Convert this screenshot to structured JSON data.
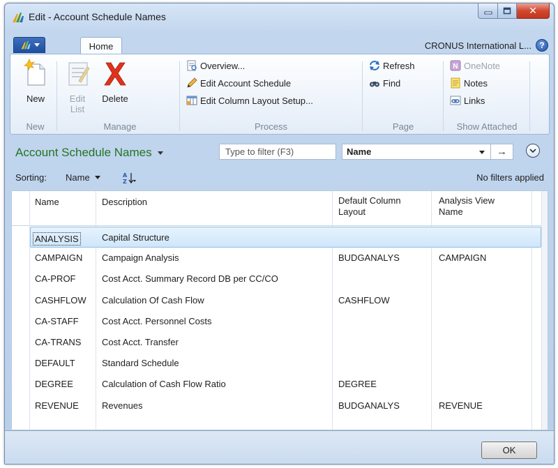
{
  "window": {
    "title": "Edit - Account Schedule Names",
    "company": "CRONUS International L...",
    "tab_home": "Home"
  },
  "ribbon": {
    "groups": {
      "new": "New",
      "manage": "Manage",
      "process": "Process",
      "page": "Page",
      "show_attached": "Show Attached"
    },
    "buttons": {
      "new": "New",
      "edit_list_1": "Edit",
      "edit_list_2": "List",
      "delete": "Delete",
      "overview": "Overview...",
      "edit_account_schedule": "Edit Account Schedule",
      "edit_column_layout": "Edit Column Layout Setup...",
      "refresh": "Refresh",
      "find": "Find",
      "onenote": "OneNote",
      "notes": "Notes",
      "links": "Links"
    }
  },
  "page": {
    "title": "Account Schedule Names",
    "filter_placeholder": "Type to filter (F3)",
    "filter_field": "Name",
    "sorting_label": "Sorting:",
    "sort_field": "Name",
    "filter_status": "No filters applied"
  },
  "grid": {
    "columns": {
      "name": "Name",
      "description": "Description",
      "default_layout_1": "Default Column",
      "default_layout_2": "Layout",
      "analysis_view_1": "Analysis View",
      "analysis_view_2": "Name"
    },
    "rows": [
      {
        "name": "ANALYSIS",
        "description": "Capital Structure",
        "layout": "",
        "view": ""
      },
      {
        "name": "CAMPAIGN",
        "description": "Campaign Analysis",
        "layout": "BUDGANALYS",
        "view": "CAMPAIGN"
      },
      {
        "name": "CA-PROF",
        "description": "Cost Acct. Summary Record DB per CC/CO",
        "layout": "",
        "view": ""
      },
      {
        "name": "CASHFLOW",
        "description": "Calculation Of Cash Flow",
        "layout": "CASHFLOW",
        "view": ""
      },
      {
        "name": "CA-STAFF",
        "description": "Cost Acct. Personnel Costs",
        "layout": "",
        "view": ""
      },
      {
        "name": "CA-TRANS",
        "description": "Cost Acct. Transfer",
        "layout": "",
        "view": ""
      },
      {
        "name": "DEFAULT",
        "description": "Standard Schedule",
        "layout": "",
        "view": ""
      },
      {
        "name": "DEGREE",
        "description": "Calculation of Cash Flow Ratio",
        "layout": "DEGREE",
        "view": ""
      },
      {
        "name": "REVENUE",
        "description": "Revenues",
        "layout": "BUDGANALYS",
        "view": "REVENUE"
      }
    ]
  },
  "footer": {
    "ok_label": "OK"
  },
  "colors": {
    "page_title_green": "#237423",
    "selection_blue": "#cfe6fa",
    "close_red": "#d2472f"
  }
}
